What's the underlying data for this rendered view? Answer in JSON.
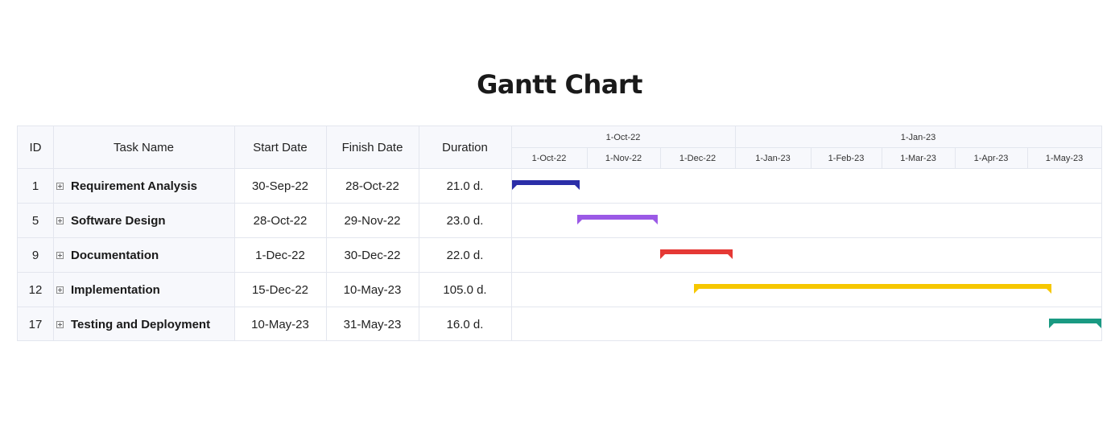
{
  "title": "Gantt Chart",
  "columns": {
    "id": "ID",
    "task_name": "Task Name",
    "start_date": "Start Date",
    "finish_date": "Finish Date",
    "duration": "Duration"
  },
  "timeline": {
    "top_labels": [
      "1-Oct-22",
      "1-Jan-23"
    ],
    "sub_labels": [
      "1-Oct-22",
      "1-Nov-22",
      "1-Dec-22",
      "1-Jan-23",
      "1-Feb-23",
      "1-Mar-23",
      "1-Apr-23",
      "1-May-23"
    ]
  },
  "tasks": [
    {
      "id": "1",
      "name": "Requirement Analysis",
      "start": "30-Sep-22",
      "finish": "28-Oct-22",
      "duration": "21.0 d.",
      "color": "#2b2ea8"
    },
    {
      "id": "5",
      "name": "Software Design",
      "start": "28-Oct-22",
      "finish": "29-Nov-22",
      "duration": "23.0 d.",
      "color": "#9b59e6"
    },
    {
      "id": "9",
      "name": "Documentation",
      "start": "1-Dec-22",
      "finish": "30-Dec-22",
      "duration": "22.0 d.",
      "color": "#e53935"
    },
    {
      "id": "12",
      "name": "Implementation",
      "start": "15-Dec-22",
      "finish": "10-May-23",
      "duration": "105.0 d.",
      "color": "#f6c700"
    },
    {
      "id": "17",
      "name": "Testing and Deployment",
      "start": "10-May-23",
      "finish": "31-May-23",
      "duration": "16.0 d.",
      "color": "#1a9a82"
    }
  ],
  "chart_data": {
    "type": "gantt",
    "title": "Gantt Chart",
    "x_range": [
      "2022-10-01",
      "2023-05-31"
    ],
    "tasks": [
      {
        "id": 1,
        "name": "Requirement Analysis",
        "start": "2022-09-30",
        "finish": "2022-10-28",
        "duration_days": 21.0
      },
      {
        "id": 5,
        "name": "Software Design",
        "start": "2022-10-28",
        "finish": "2022-11-29",
        "duration_days": 23.0
      },
      {
        "id": 9,
        "name": "Documentation",
        "start": "2022-12-01",
        "finish": "2022-12-30",
        "duration_days": 22.0
      },
      {
        "id": 12,
        "name": "Implementation",
        "start": "2022-12-15",
        "finish": "2023-05-10",
        "duration_days": 105.0
      },
      {
        "id": 17,
        "name": "Testing and Deployment",
        "start": "2023-05-10",
        "finish": "2023-05-31",
        "duration_days": 16.0
      }
    ]
  }
}
